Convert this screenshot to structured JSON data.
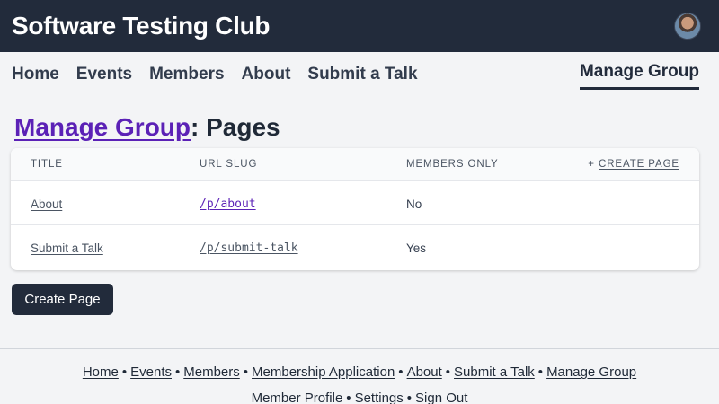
{
  "site": {
    "title": "Software Testing Club"
  },
  "nav": {
    "items": [
      "Home",
      "Events",
      "Members",
      "About",
      "Submit a Talk"
    ],
    "active": "Manage Group"
  },
  "heading": {
    "link": "Manage Group",
    "suffix": ": Pages"
  },
  "table": {
    "columns": [
      "Title",
      "URL Slug",
      "Members Only"
    ],
    "create_link": "Create Page",
    "create_prefix": "+",
    "rows": [
      {
        "title": "About",
        "slug": "/p/about",
        "members_only": "No"
      },
      {
        "title": "Submit a Talk",
        "slug": "/p/submit-talk",
        "members_only": "Yes"
      }
    ]
  },
  "button": {
    "create": "Create Page"
  },
  "footer": {
    "line1": [
      "Home",
      "Events",
      "Members",
      "Membership Application",
      "About",
      "Submit a Talk",
      "Manage Group"
    ],
    "line2": [
      "Member Profile",
      "Settings",
      "Sign Out"
    ],
    "separator": "•"
  },
  "colors": {
    "header_bg": "#222b3b",
    "link_purple": "#5b21b6",
    "page_bg": "#f3f4f6"
  }
}
